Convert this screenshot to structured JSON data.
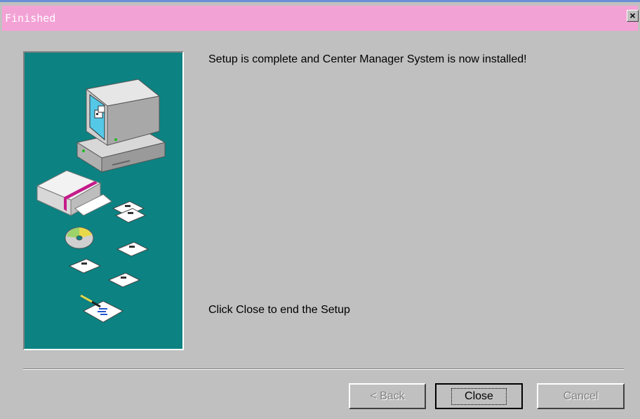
{
  "window": {
    "title": "Finished",
    "close_glyph": "✕"
  },
  "content": {
    "complete_message": "Setup is complete and Center Manager System is now installed!",
    "instruction": "Click Close to end the Setup"
  },
  "buttons": {
    "back": "< Back",
    "close": "Close",
    "cancel": "Cancel"
  },
  "colors": {
    "title_bar": "#f3a2d6",
    "art_background": "#0c8282",
    "dialog_background": "#c0c0c0"
  },
  "icons": [
    "computer-icon",
    "software-box-icon",
    "cd-icon",
    "floppy-disk-icon",
    "document-pen-icon"
  ]
}
